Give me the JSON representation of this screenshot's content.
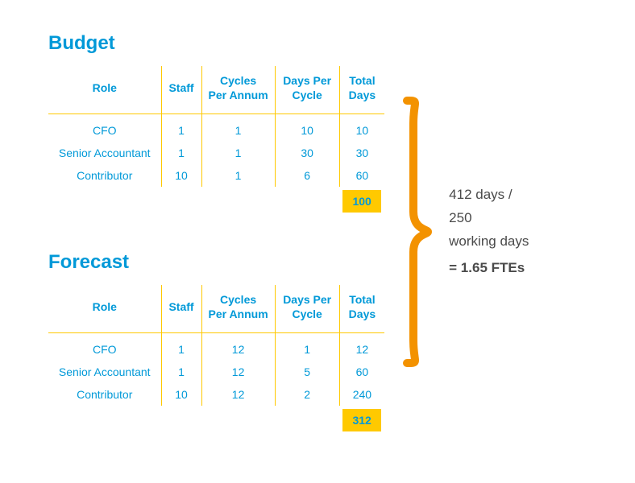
{
  "chart_data": [
    {
      "type": "table",
      "title": "Budget",
      "columns": [
        "Role",
        "Staff",
        "Cycles Per Annum",
        "Days Per Cycle",
        "Total Days"
      ],
      "rows": [
        {
          "role": "CFO",
          "staff": 1,
          "cycles": 1,
          "days_per_cycle": 10,
          "total_days": 10
        },
        {
          "role": "Senior Accountant",
          "staff": 1,
          "cycles": 1,
          "days_per_cycle": 30,
          "total_days": 30
        },
        {
          "role": "Contributor",
          "staff": 10,
          "cycles": 1,
          "days_per_cycle": 6,
          "total_days": 60
        }
      ],
      "total_days_sum": 100
    },
    {
      "type": "table",
      "title": "Forecast",
      "columns": [
        "Role",
        "Staff",
        "Cycles Per Annum",
        "Days Per Cycle",
        "Total Days"
      ],
      "rows": [
        {
          "role": "CFO",
          "staff": 1,
          "cycles": 12,
          "days_per_cycle": 1,
          "total_days": 12
        },
        {
          "role": "Senior Accountant",
          "staff": 1,
          "cycles": 12,
          "days_per_cycle": 5,
          "total_days": 60
        },
        {
          "role": "Contributor",
          "staff": 10,
          "cycles": 12,
          "days_per_cycle": 2,
          "total_days": 240
        }
      ],
      "total_days_sum": 312
    }
  ],
  "budget": {
    "title": "Budget",
    "headers": {
      "role": "Role",
      "staff": "Staff",
      "cycles": "Cycles\nPer Annum",
      "days": "Days Per\nCycle",
      "total": "Total\nDays"
    },
    "rows": [
      {
        "role": "CFO",
        "staff": "1",
        "cycles": "1",
        "days": "10",
        "total": "10"
      },
      {
        "role": "Senior Accountant",
        "staff": "1",
        "cycles": "1",
        "days": "30",
        "total": "30"
      },
      {
        "role": "Contributor",
        "staff": "10",
        "cycles": "1",
        "days": "6",
        "total": "60"
      }
    ],
    "sum": "100"
  },
  "forecast": {
    "title": "Forecast",
    "headers": {
      "role": "Role",
      "staff": "Staff",
      "cycles": "Cycles\nPer Annum",
      "days": "Days Per\nCycle",
      "total": "Total\nDays"
    },
    "rows": [
      {
        "role": "CFO",
        "staff": "1",
        "cycles": "12",
        "days": "1",
        "total": "12"
      },
      {
        "role": "Senior Accountant",
        "staff": "1",
        "cycles": "12",
        "days": "5",
        "total": "60"
      },
      {
        "role": "Contributor",
        "staff": "10",
        "cycles": "12",
        "days": "2",
        "total": "240"
      }
    ],
    "sum": "312"
  },
  "summary": {
    "line1": "412 days /",
    "line2": "250",
    "line3": "working days",
    "fte": "= 1.65 FTEs"
  },
  "colors": {
    "blue": "#0099d8",
    "orange": "#f39200",
    "yellow": "#ffc900"
  }
}
